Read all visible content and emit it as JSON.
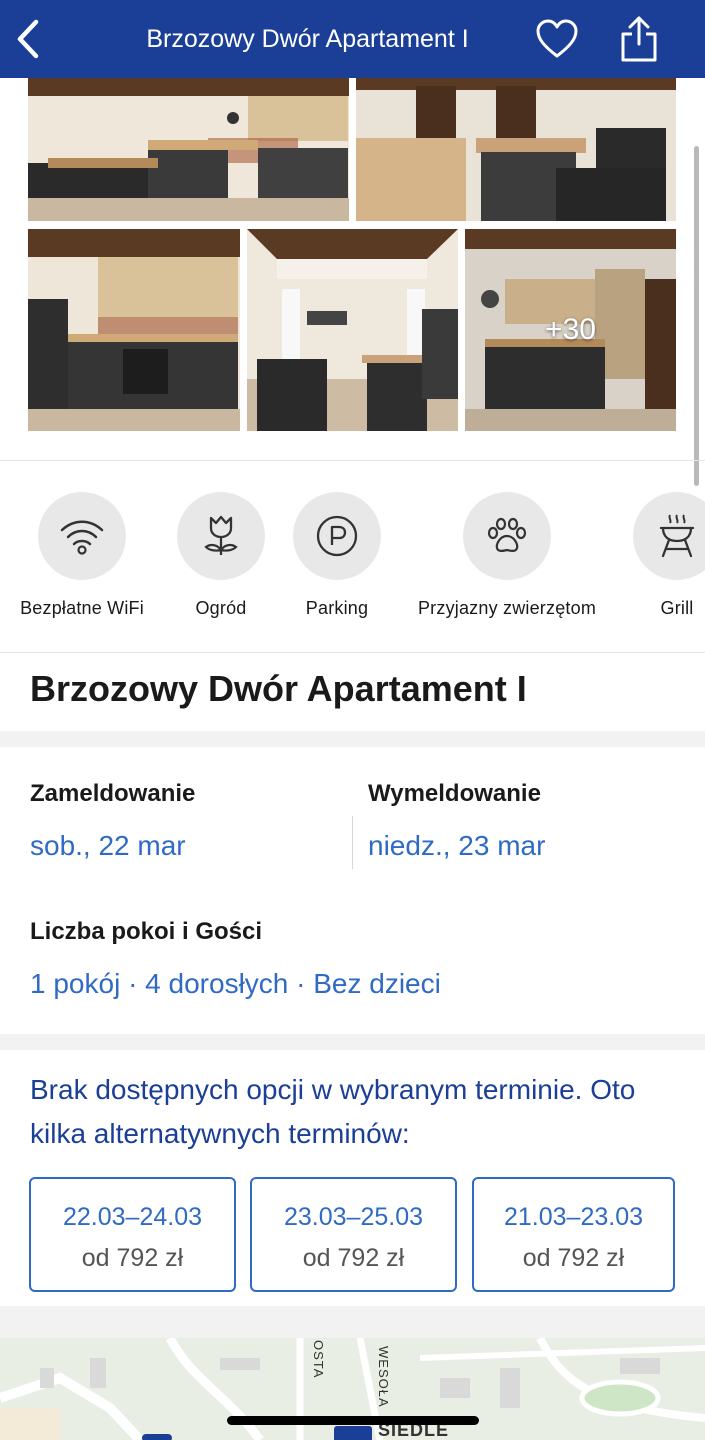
{
  "header": {
    "title": "Brzozowy Dwór Apartament I",
    "back_icon": "chevron-left-icon",
    "favorite_icon": "heart-outline-icon",
    "share_icon": "share-icon"
  },
  "photos": {
    "more_count": "+30"
  },
  "amenities": [
    {
      "label": "Bezpłatne WiFi",
      "icon": "wifi-icon"
    },
    {
      "label": "Ogród",
      "icon": "flower-icon"
    },
    {
      "label": "Parking",
      "icon": "parking-icon"
    },
    {
      "label": "Przyjazny zwierzętom",
      "icon": "paw-icon"
    },
    {
      "label": "Grill",
      "icon": "grill-icon"
    }
  ],
  "property": {
    "name": "Brzozowy Dwór Apartament I"
  },
  "booking": {
    "checkin_label": "Zameldowanie",
    "checkin_value": "sob., 22 mar",
    "checkout_label": "Wymeldowanie",
    "checkout_value": "niedz., 23 mar",
    "rooms_label": "Liczba pokoi i Gości",
    "rooms_value": "1 pokój · 4 dorosłych · Bez dzieci"
  },
  "availability": {
    "notice": "Brak dostępnych opcji w wybranym terminie. Oto kilka alternatywnych terminów:",
    "alternatives": [
      {
        "dates": "22.03–24.03",
        "price": "od 792 zł"
      },
      {
        "dates": "23.03–25.03",
        "price": "od 792 zł"
      },
      {
        "dates": "21.03–23.03",
        "price": "od 792 zł"
      }
    ]
  },
  "map": {
    "labels": [
      "OSTA",
      "WESOŁA",
      "SIEDLE"
    ]
  },
  "colors": {
    "header": "#1b3f97",
    "link": "#2f6bc4",
    "notice": "#1b3f97"
  }
}
